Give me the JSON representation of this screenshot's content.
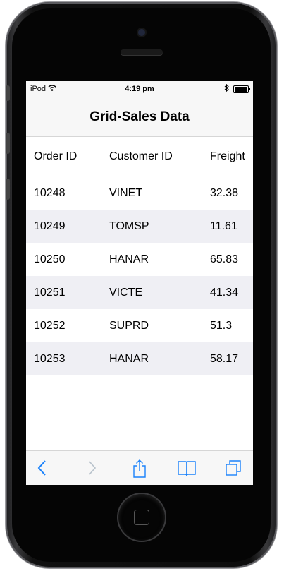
{
  "status_bar": {
    "carrier": "iPod",
    "time": "4:19 pm"
  },
  "page_title": "Grid-Sales Data",
  "grid": {
    "headers": [
      "Order ID",
      "Customer ID",
      "Freight"
    ],
    "rows": [
      [
        "10248",
        "VINET",
        "32.38"
      ],
      [
        "10249",
        "TOMSP",
        "11.61"
      ],
      [
        "10250",
        "HANAR",
        "65.83"
      ],
      [
        "10251",
        "VICTE",
        "41.34"
      ],
      [
        "10252",
        "SUPRD",
        "51.3"
      ],
      [
        "10253",
        "HANAR",
        "58.17"
      ]
    ]
  },
  "toolbar": {
    "icons": [
      "back-icon",
      "forward-icon",
      "share-icon",
      "bookmarks-icon",
      "tabs-icon"
    ]
  },
  "colors": {
    "accent": "#1a82fb",
    "alt_row": "#efeff4",
    "bar_bg": "#f7f7f7"
  }
}
